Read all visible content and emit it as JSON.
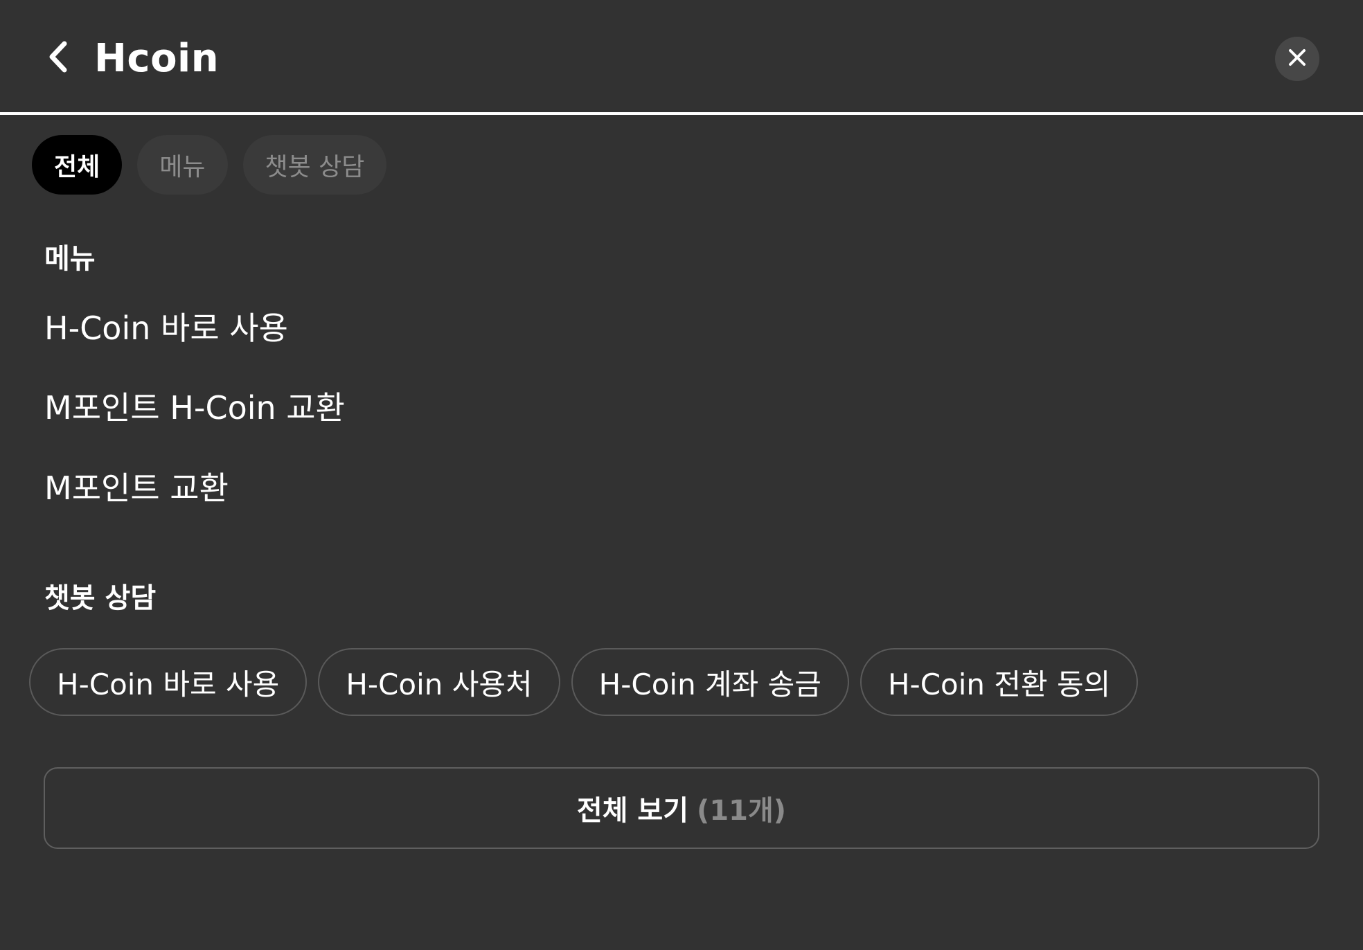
{
  "header": {
    "title": "Hcoin",
    "back_icon": "chevron-left-icon",
    "close_icon": "close-icon"
  },
  "tabs": [
    {
      "label": "전체",
      "active": true
    },
    {
      "label": "메뉴",
      "active": false
    },
    {
      "label": "챗봇 상담",
      "active": false
    }
  ],
  "menu_section": {
    "title": "메뉴",
    "items": [
      "H-Coin 바로 사용",
      "M포인트 H-Coin 교환",
      "M포인트 교환"
    ]
  },
  "chatbot_section": {
    "title": "챗봇 상담",
    "chips": [
      "H-Coin 바로 사용",
      "H-Coin 사용처",
      "H-Coin 계좌 송금",
      "H-Coin 전환 동의"
    ]
  },
  "view_all": {
    "label": "전체 보기",
    "count": "(11개)"
  },
  "colors": {
    "background": "#323232",
    "active_tab": "#000000",
    "inactive_tab": "#3a3a3a",
    "muted_text": "#8a8a8a"
  }
}
